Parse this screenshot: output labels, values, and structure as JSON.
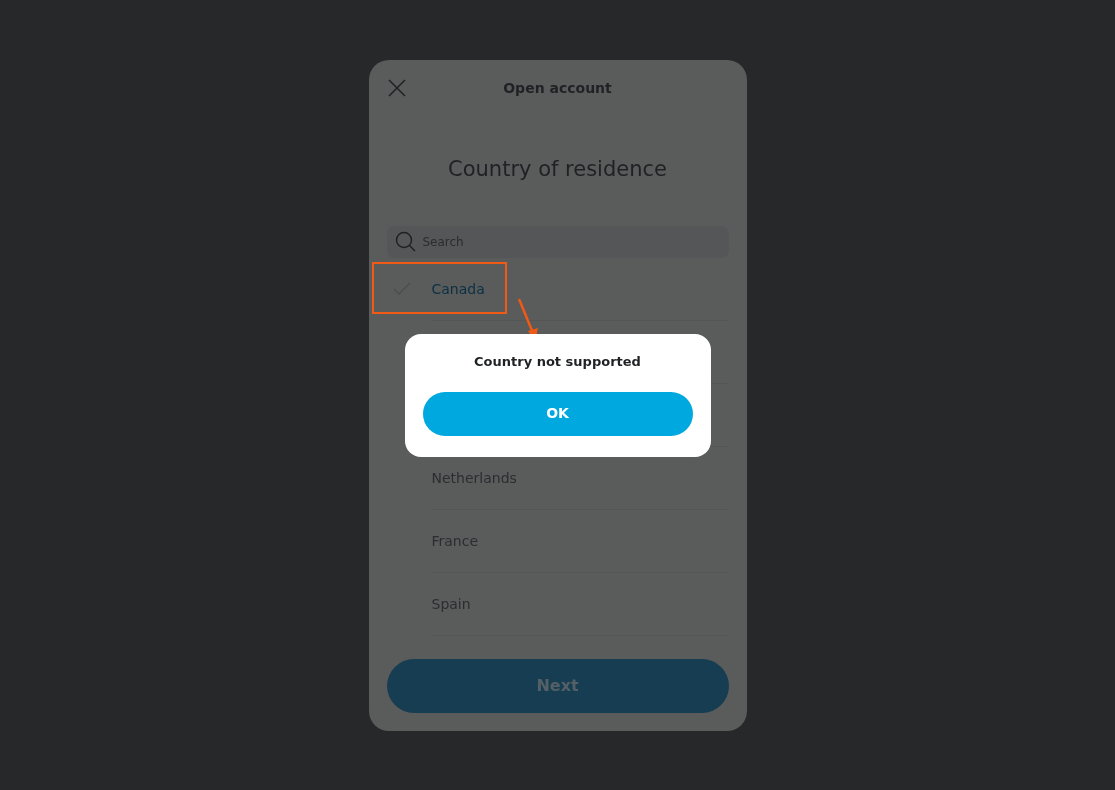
{
  "header": {
    "title": "Open account"
  },
  "heading": "Country of residence",
  "search": {
    "placeholder": "Search"
  },
  "countries": [
    {
      "name": "Canada",
      "selected": true,
      "highlighted": true
    },
    {
      "name": "Netherlands",
      "selected": false,
      "highlighted": false
    },
    {
      "name": "France",
      "selected": false,
      "highlighted": false
    },
    {
      "name": "Spain",
      "selected": false,
      "highlighted": false
    }
  ],
  "next_button": {
    "label": "Next",
    "disabled": true
  },
  "dialog": {
    "message": "Country not supported",
    "button": "OK"
  }
}
